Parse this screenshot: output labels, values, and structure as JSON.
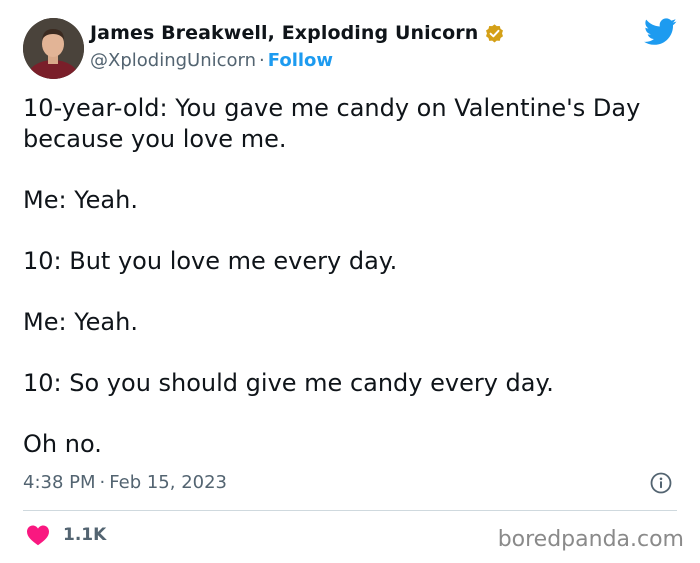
{
  "author": {
    "display_name": "James Breakwell, Exploding Unicorn",
    "handle": "@XplodingUnicorn",
    "separator": "·",
    "follow_label": "Follow",
    "verified_color": "#d4a017"
  },
  "icons": {
    "brand": "twitter-bird-icon",
    "verified": "verified-badge-icon",
    "info": "info-icon",
    "like": "heart-icon"
  },
  "tweet": {
    "lines": [
      "10-year-old: You gave me candy on Valentine's Day because you love me.",
      "Me: Yeah.",
      "10: But you love me every day.",
      "Me: Yeah.",
      "10: So you should give me candy every day.",
      "Oh no."
    ],
    "time": "4:38 PM",
    "separator": "·",
    "date": "Feb 15, 2023"
  },
  "engagement": {
    "likes": "1.1K"
  },
  "watermark": "boredpanda.com",
  "colors": {
    "twitter_blue": "#1d9bf0",
    "like_pink": "#f91880",
    "secondary_text": "#536471"
  }
}
